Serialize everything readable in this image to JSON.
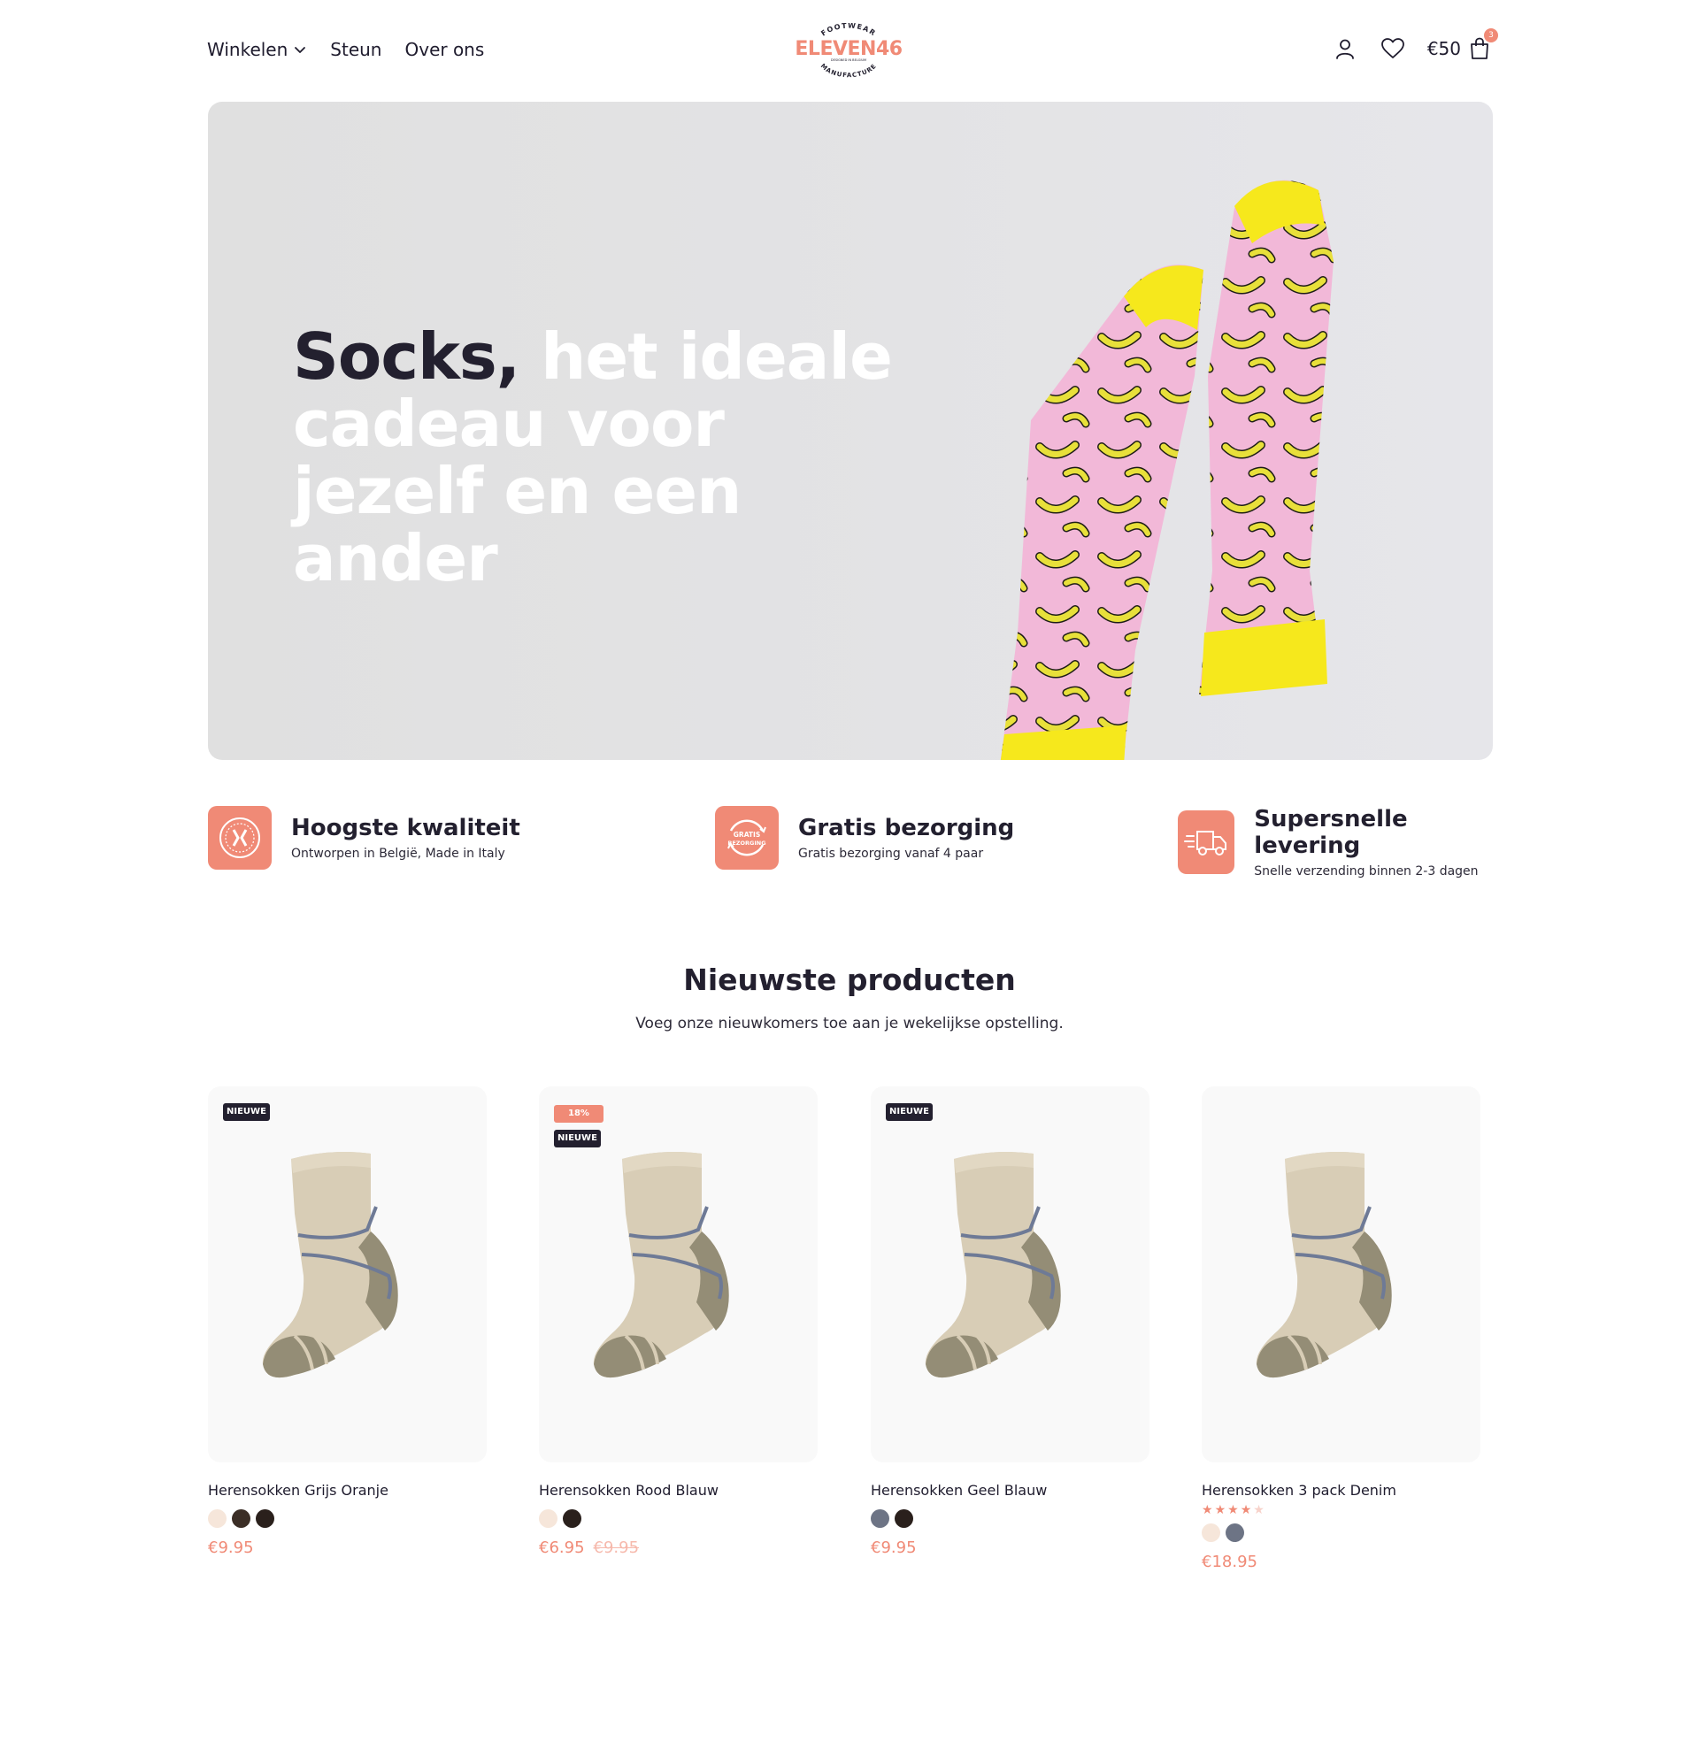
{
  "header": {
    "nav": [
      {
        "label": "Winkelen"
      },
      {
        "label": "Steun"
      },
      {
        "label": "Over ons"
      }
    ],
    "logo": {
      "top": "FOOTWEAR",
      "brand": "ELEVEN46",
      "mid": "DESIGNED IN BELGIUM",
      "bottom": "MANUFACTURE"
    },
    "cart_total": "€50",
    "cart_count": "3"
  },
  "hero": {
    "title_dark": "Socks,",
    "title_light": "het ideale cadeau voor jezelf en een ander"
  },
  "features": [
    {
      "title": "Hoogste kwaliteit",
      "subtitle": "Ontworpen in België, Made in Italy",
      "icon": "quality-seal-icon"
    },
    {
      "title": "Gratis bezorging",
      "subtitle": "Gratis bezorging vanaf 4 paar",
      "icon": "free-delivery-icon",
      "icon_text": "GRATIS BEZORGING"
    },
    {
      "title": "Supersnelle levering",
      "subtitle": "Snelle verzending binnen 2-3 dagen",
      "icon": "delivery-truck-icon"
    }
  ],
  "section": {
    "title": "Nieuwste producten",
    "subtitle": "Voeg onze nieuwkomers toe aan je wekelijkse opstelling."
  },
  "products": [
    {
      "name": "Herensokken Grijs Oranje",
      "badge_new": "NIEUWE",
      "price": "€9.95"
    },
    {
      "name": "Herensokken Rood Blauw",
      "badge_sale": "18%",
      "badge_new": "NIEUWE",
      "price": "€6.95",
      "price_old": "€9.95"
    },
    {
      "name": "Herensokken Geel Blauw",
      "badge_new": "NIEUWE",
      "price": "€9.95"
    },
    {
      "name": "Herensokken 3 pack Denim",
      "rating": 4,
      "price": "€18.95"
    }
  ],
  "colors": {
    "accent": "#f08a76",
    "dark": "#23202f",
    "swatch_cream": "#f6e6da",
    "swatch_brown": "#3b2e26",
    "swatch_black": "#2a201c",
    "swatch_grey": "#6d7485"
  }
}
